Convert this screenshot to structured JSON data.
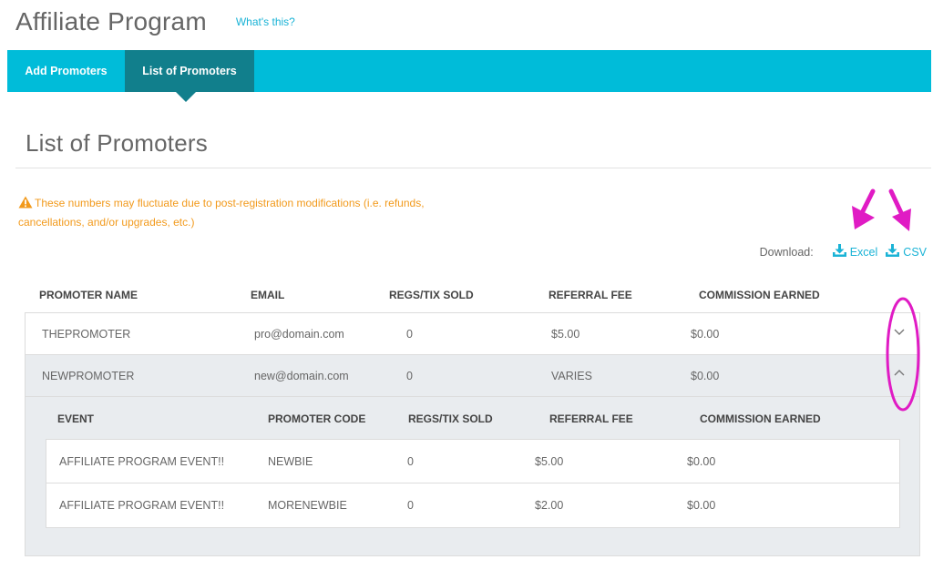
{
  "header": {
    "title": "Affiliate Program",
    "help_link": "What's this?"
  },
  "tabs": [
    {
      "label": "Add Promoters",
      "active": false
    },
    {
      "label": "List of Promoters",
      "active": true
    }
  ],
  "section": {
    "title": "List of Promoters"
  },
  "warning": {
    "text": "These numbers may fluctuate due to post-registration modifications (i.e. refunds, cancellations, and/or upgrades, etc.)"
  },
  "download": {
    "label": "Download:",
    "excel": "Excel",
    "csv": "CSV"
  },
  "columns": [
    "PROMOTER NAME",
    "EMAIL",
    "REGS/TIX SOLD",
    "REFERRAL FEE",
    "COMMISSION EARNED"
  ],
  "promoters": [
    {
      "name": "THEPROMOTER",
      "email": "pro@domain.com",
      "sold": "0",
      "fee": "$5.00",
      "commission": "$0.00",
      "expanded": false
    },
    {
      "name": "NEWPROMOTER",
      "email": "new@domain.com",
      "sold": "0",
      "fee": "VARIES",
      "commission": "$0.00",
      "expanded": true
    }
  ],
  "sub_columns": [
    "EVENT",
    "PROMOTER CODE",
    "REGS/TIX SOLD",
    "REFERRAL FEE",
    "COMMISSION EARNED"
  ],
  "events": [
    {
      "event": "AFFILIATE PROGRAM EVENT!!",
      "code": "NEWBIE",
      "sold": "0",
      "fee": "$5.00",
      "commission": "$0.00"
    },
    {
      "event": "AFFILIATE PROGRAM EVENT!!",
      "code": "MORENEWBIE",
      "sold": "0",
      "fee": "$2.00",
      "commission": "$0.00"
    }
  ],
  "colors": {
    "accent": "#00bcd9",
    "tab_active": "#117f8c",
    "warning": "#f29a1c",
    "link": "#1ab3d6",
    "annotation": "#e01bc4"
  },
  "icons": [
    "warning-triangle-icon",
    "download-icon",
    "chevron-down-icon",
    "chevron-up-icon"
  ]
}
